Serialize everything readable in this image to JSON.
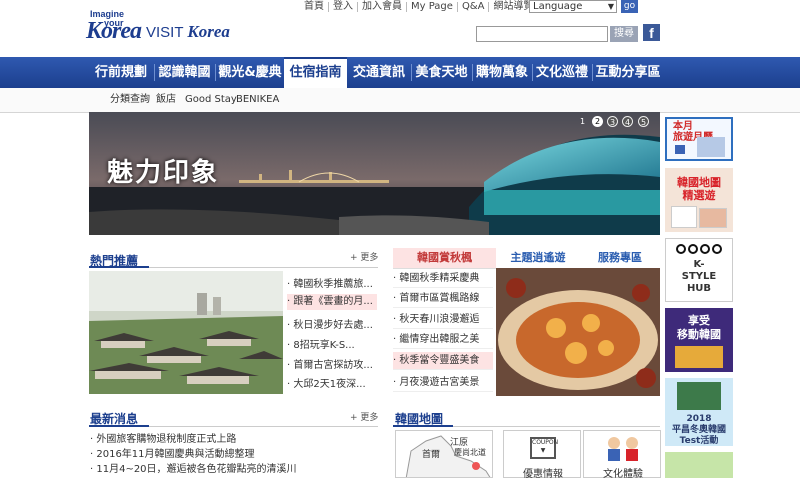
{
  "util_links": [
    "首頁",
    "登入",
    "加入會員",
    "My Page",
    "Q&A",
    "網站導覽"
  ],
  "language": {
    "selected": "Language",
    "go": "go"
  },
  "logo": {
    "imagine": "Imagine",
    "your": "your",
    "korea": "Korea",
    "visit": "VISIT",
    "visit_korea": "Korea"
  },
  "search": {
    "placeholder": "",
    "button": "搜尋"
  },
  "facebook_label": "f",
  "nav": [
    "行前規劃",
    "認識韓國",
    "觀光&慶典",
    "住宿指南",
    "交通資訊",
    "美食天地",
    "購物萬象",
    "文化巡禮",
    "互動分享區"
  ],
  "nav_active": "住宿指南",
  "subnav": [
    "分類查詢",
    "飯店",
    "Good Stay",
    "BENIKEA"
  ],
  "hero": {
    "title": "魅力印象",
    "pages": [
      "1",
      "2",
      "3",
      "4",
      "5"
    ],
    "active_page": "1"
  },
  "right_banners": {
    "monthly": "本月\n旅遊月曆",
    "map_pick": "韓國地圖\n精選遊",
    "kstyle": [
      "K-",
      "STYLE",
      "HUB"
    ],
    "mobile": "享受\n移動韓國",
    "pyeongchang": "2018\n平昌冬奧韓國\nTest活動"
  },
  "hot": {
    "title": "熱門推薦",
    "more": "更多",
    "items": [
      "韓國秋季推薦旅...",
      "跟著《雲畫的月...",
      "秋日漫步好去處...",
      "8招玩享K-S...",
      "首爾古宮探訪攻...",
      "大邱2天1夜深..."
    ],
    "selected_index": 1
  },
  "center_tabs": {
    "tabs": [
      "韓國賞秋楓",
      "主題逍遙遊",
      "服務專區"
    ],
    "active": 0
  },
  "autumn_items": [
    "韓國秋季精采慶典",
    "首爾市區賞楓路線",
    "秋天春川浪漫邂逅",
    "繼情穿出韓服之美",
    "秋季當令豐盛美食",
    "月夜漫遊古宮美景"
  ],
  "autumn_selected": 4,
  "news": {
    "title": "最新消息",
    "more": "更多",
    "items": [
      "外國旅客購物退稅制度正式上路",
      "2016年11月韓國慶典與活動總整理",
      "11月4~20日，邂逅被各色花瓣點亮的清溪川"
    ]
  },
  "map": {
    "title": "韓國地圖",
    "labels": [
      "首爾",
      "江原",
      "慶尚北道"
    ],
    "info_label": "優惠情報",
    "culture_label": "文化體驗",
    "coupon_tag": "COUPON"
  },
  "colors": {
    "nav": "#1c3f8e",
    "accent_red": "#d8232a",
    "highlight": "#fde3e3",
    "link_blue": "#2a5db0"
  }
}
